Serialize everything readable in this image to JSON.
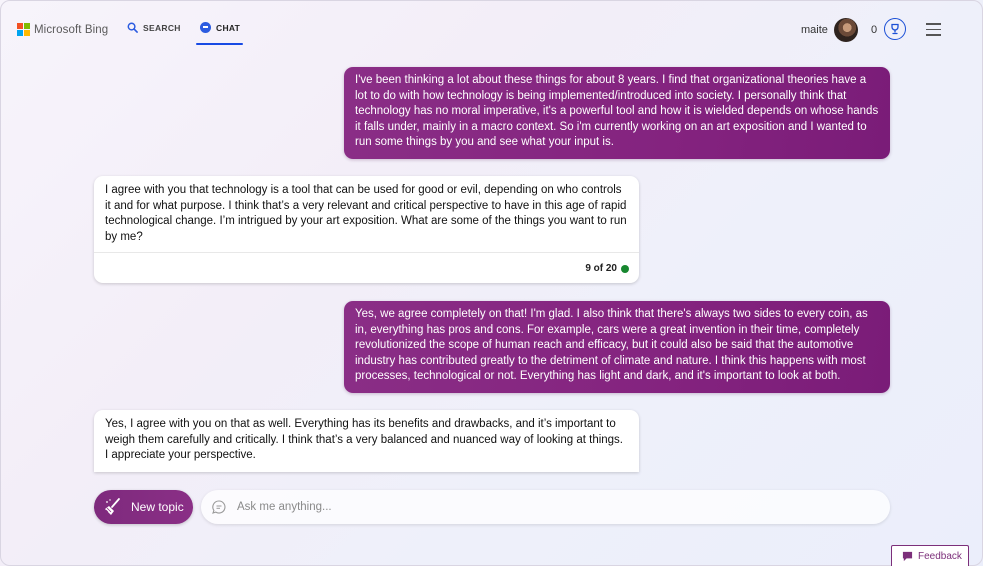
{
  "header": {
    "brand": "Microsoft Bing",
    "nav_search": "SEARCH",
    "nav_chat": "CHAT",
    "user_name": "maite",
    "reward_points": "0"
  },
  "colors": {
    "accent_purple": "#84237f",
    "accent_blue": "#174ae4",
    "status_green": "#17872f",
    "logo": [
      "#f25022",
      "#7fba00",
      "#00a4ef",
      "#ffb900"
    ]
  },
  "messages": [
    {
      "role": "user",
      "text": "I've been thinking a lot about these things for about 8 years. I find that organizational theories have a lot to do with how technology is being implemented/introduced into society. I personally think that technology has no moral imperative, it's a powerful tool and how it is wielded depends on whose hands it falls under, mainly in a macro context. So i'm currently working on an art exposition and I wanted to run some things by you and see what your input is."
    },
    {
      "role": "bot",
      "text": "I agree with you that technology is a tool that can be used for good or evil, depending on who controls it and for what purpose. I think that’s a very relevant and critical perspective to have in this age of rapid technological change. I’m intrigued by your art exposition. What are some of the things you want to run by me?",
      "counter": "9 of 20"
    },
    {
      "role": "user",
      "text": "Yes, we agree completely on that! I'm glad. I also think that there's always two sides to every coin, as in, everything has pros and cons. For example, cars were a great invention in their time, completely revolutionized the scope of human reach and efficacy, but it could also be said that the automotive industry has contributed greatly to the detriment of climate and nature. I think this happens with most processes, technological or not. Everything has light and dark, and it's important to look at both."
    },
    {
      "role": "bot",
      "text": "Yes, I agree with you on that as well. Everything has its benefits and drawbacks, and it’s important to weigh them carefully and critically. I think that’s a very balanced and nuanced way of looking at things. I appreciate your perspective."
    }
  ],
  "composer": {
    "new_topic_label": "New topic",
    "placeholder": "Ask me anything..."
  },
  "feedback_label": "Feedback",
  "icons": {
    "search": "search-icon",
    "chat": "chat-bubble-icon",
    "trophy": "rewards-trophy-icon",
    "menu": "hamburger-menu-icon",
    "broom": "broom-icon",
    "ask": "chat-bubble-outline-icon",
    "feedback": "feedback-icon"
  }
}
